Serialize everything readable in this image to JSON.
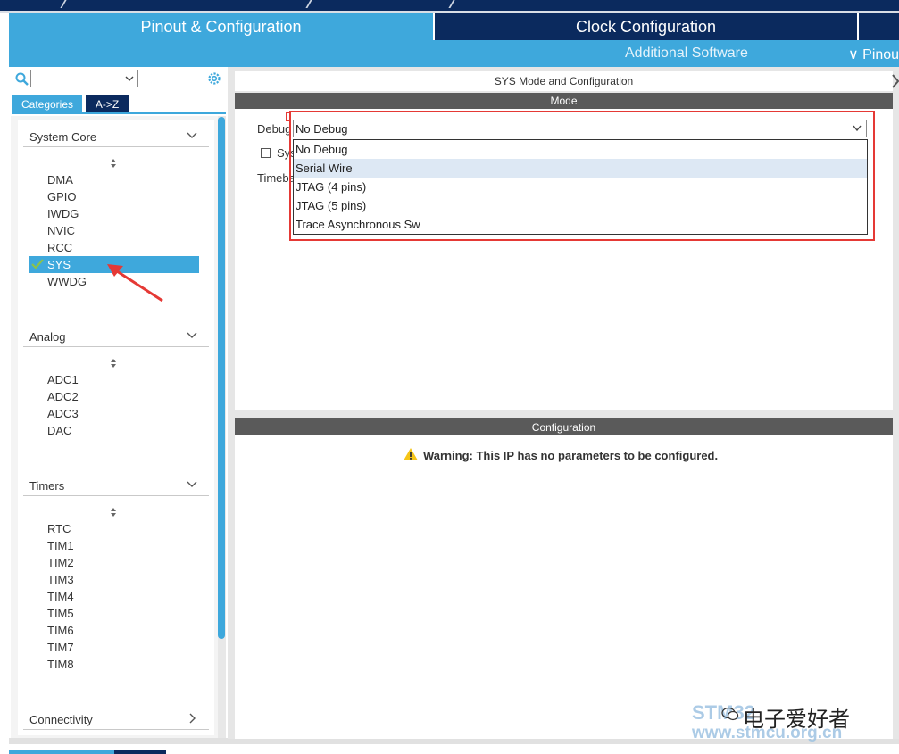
{
  "tabs": {
    "pinout": "Pinout & Configuration",
    "clock": "Clock Configuration"
  },
  "subbar": {
    "additional_software": "Additional Software",
    "pinout_view": "∨ Pinou"
  },
  "left": {
    "categories_tab": "Categories",
    "az_tab": "A->Z",
    "sections": [
      {
        "title": "System Core",
        "items": [
          "DMA",
          "GPIO",
          "IWDG",
          "NVIC",
          "RCC",
          "SYS",
          "WWDG"
        ]
      },
      {
        "title": "Analog",
        "items": [
          "ADC1",
          "ADC2",
          "ADC3",
          "DAC"
        ]
      },
      {
        "title": "Timers",
        "items": [
          "RTC",
          "TIM1",
          "TIM2",
          "TIM3",
          "TIM4",
          "TIM5",
          "TIM6",
          "TIM7",
          "TIM8"
        ]
      },
      {
        "title": "Connectivity",
        "items": []
      }
    ],
    "selected_item": "SYS"
  },
  "panel": {
    "title": "SYS Mode and Configuration",
    "mode_header": "Mode",
    "debug_label": "Debug",
    "sysw_label": "Sys",
    "timebase_label": "Timeba",
    "debug_value": "No Debug",
    "debug_options": [
      "No Debug",
      "Serial Wire",
      "JTAG (4 pins)",
      "JTAG (5 pins)",
      "Trace Asynchronous Sw"
    ],
    "highlighted_option": "Serial Wire",
    "config_header": "Configuration",
    "warning": "Warning: This IP has no parameters to be configured."
  },
  "watermark": {
    "line1": "STM32",
    "line2": "www.stmcu.org.cn",
    "overlay": "电子爱好者"
  },
  "colors": {
    "accent_blue": "#3ea8dc",
    "navy": "#0b2a5e",
    "header_gray": "#5a5a5a",
    "annotation_red": "#e53935",
    "check_green": "#8bc34a"
  }
}
